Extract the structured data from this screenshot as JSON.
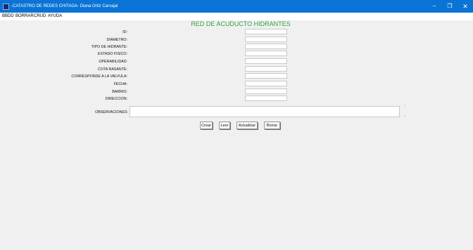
{
  "window": {
    "title": "-CATASTRO DE REDES CHITAGA- Diana Ortiz Carvajal",
    "minimize": "–",
    "maximize": "❐",
    "close": "✕",
    "app_icon": "app-window-icon"
  },
  "menu": [
    "BBDD",
    "BORRAR",
    "CRUD",
    "AYUDA"
  ],
  "form": {
    "title": "RED DE ACUDUCTO HIDRANTES",
    "fields": [
      {
        "label": "ID:",
        "value": ""
      },
      {
        "label": "DIAMETRO:",
        "value": ""
      },
      {
        "label": "TIPO DE HIDRANTE:",
        "value": ""
      },
      {
        "label": "ESTADO FISICO:",
        "value": ""
      },
      {
        "label": "OPERABILIDAD:",
        "value": ""
      },
      {
        "label": "COTA RASANTE:",
        "value": ""
      },
      {
        "label": "CORRESPONDE A LA VALVULA:",
        "value": ""
      },
      {
        "label": "FECHA:",
        "value": ""
      },
      {
        "label": "BARRIO:",
        "value": ""
      },
      {
        "label": "DIRECCION:",
        "value": ""
      }
    ],
    "observaciones_label": "OBSERVACIONES:",
    "observaciones_value": ""
  },
  "buttons": {
    "crear": "Crear",
    "leer": "Leer",
    "actualizar": "Actualizar",
    "borrar": "Borrar"
  }
}
